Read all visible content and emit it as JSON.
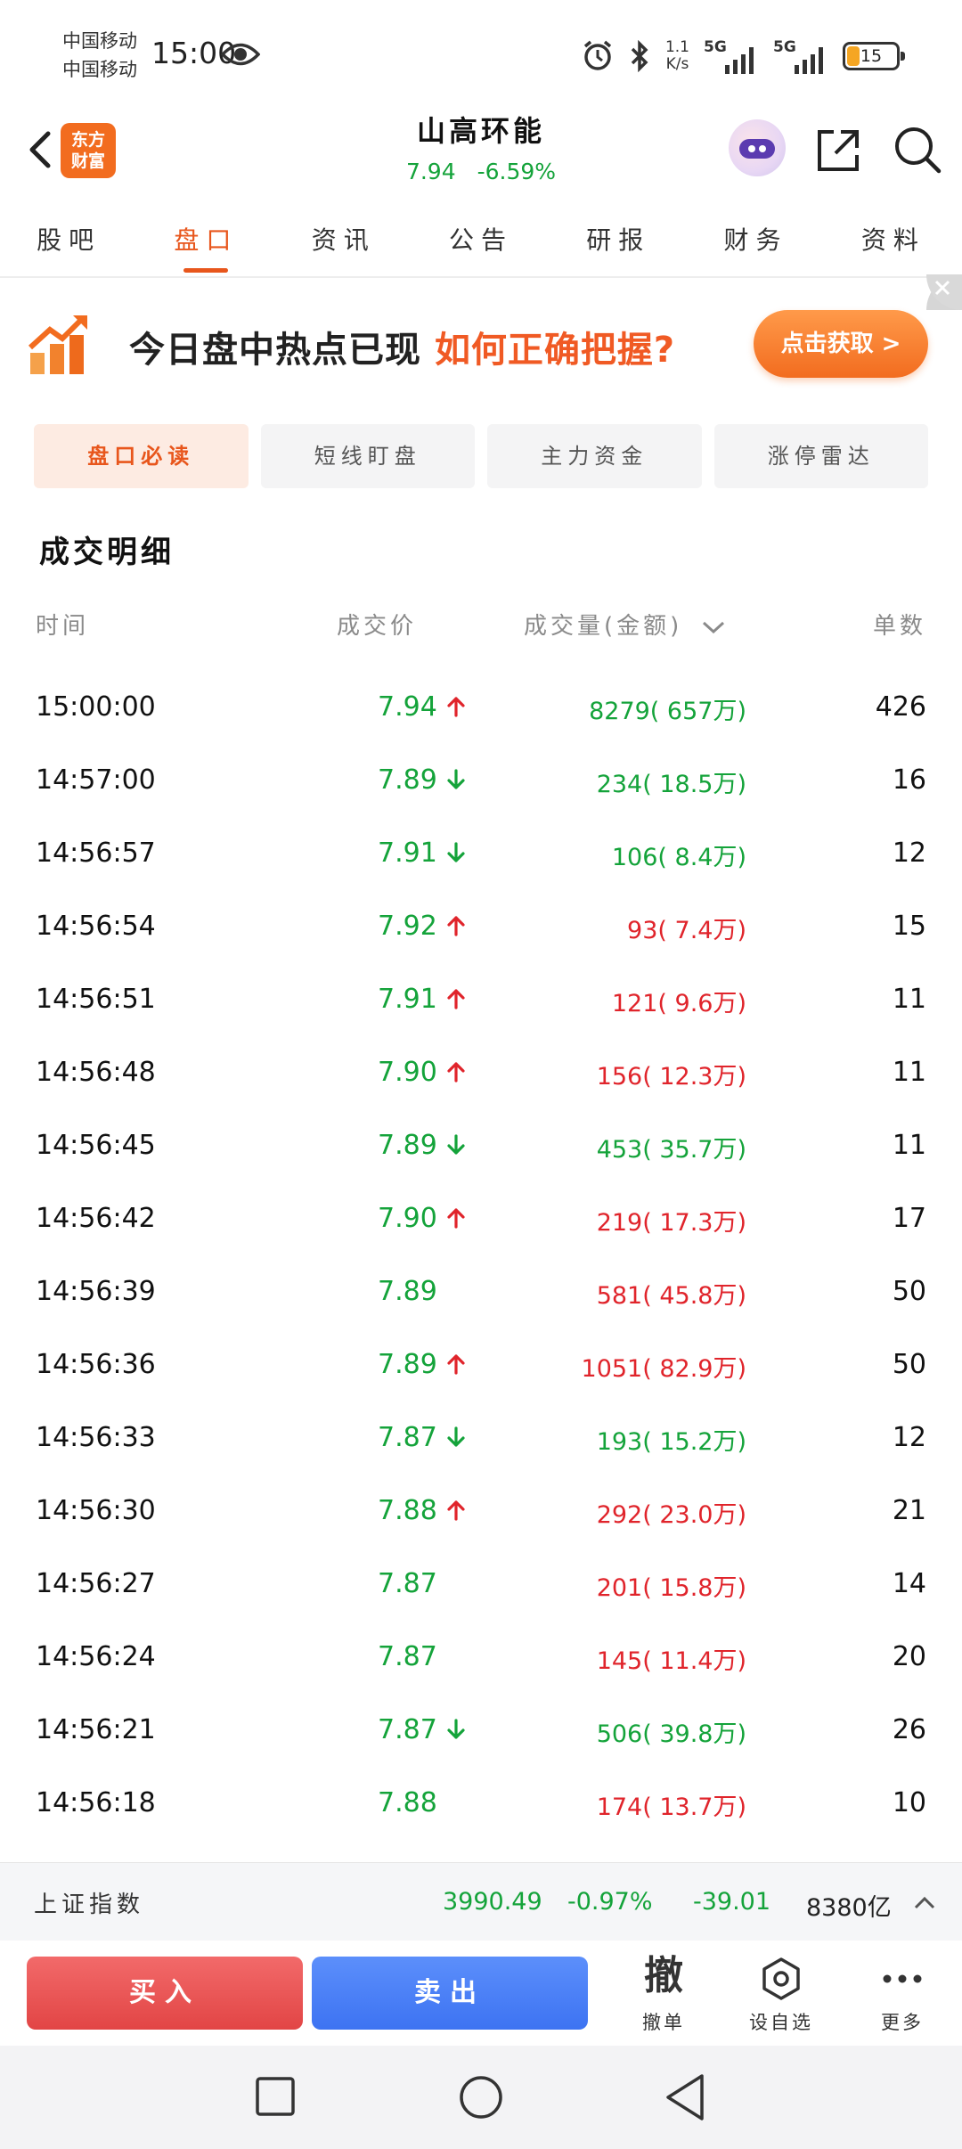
{
  "status_bar": {
    "carrier_line1": "中国移动",
    "carrier_line2": "中国移动",
    "time": "15:00",
    "net_speed_value": "1.1",
    "net_speed_unit": "K/s",
    "signal1_label": "5G",
    "signal2_label": "5G",
    "battery_level": "15"
  },
  "header": {
    "brand_line1": "东方",
    "brand_line2": "财富",
    "stock_name": "山高环能",
    "price": "7.94",
    "change_pct": "-6.59%"
  },
  "tabs": [
    {
      "label": "股吧",
      "active": false
    },
    {
      "label": "盘口",
      "active": true
    },
    {
      "label": "资讯",
      "active": false
    },
    {
      "label": "公告",
      "active": false
    },
    {
      "label": "研报",
      "active": false
    },
    {
      "label": "财务",
      "active": false
    },
    {
      "label": "资料",
      "active": false
    }
  ],
  "banner": {
    "text_main": "今日盘中热点已现",
    "text_highlight": "如何正确把握?",
    "button_label": "点击获取 >"
  },
  "subtabs": [
    {
      "label": "盘口必读",
      "active": true
    },
    {
      "label": "短线盯盘",
      "active": false
    },
    {
      "label": "主力资金",
      "active": false
    },
    {
      "label": "涨停雷达",
      "active": false
    }
  ],
  "section_title": "成交明细",
  "table": {
    "headers": {
      "time": "时间",
      "price": "成交价",
      "volume": "成交量(金额)",
      "count": "单数"
    },
    "rows": [
      {
        "time": "15:00:00",
        "price": "7.94",
        "arrow": "up",
        "volume": "8279( 657万)",
        "vol_color": "green",
        "count": "426"
      },
      {
        "time": "14:57:00",
        "price": "7.89",
        "arrow": "down",
        "volume": "234( 18.5万)",
        "vol_color": "green",
        "count": "16"
      },
      {
        "time": "14:56:57",
        "price": "7.91",
        "arrow": "down",
        "volume": "106( 8.4万)",
        "vol_color": "green",
        "count": "12"
      },
      {
        "time": "14:56:54",
        "price": "7.92",
        "arrow": "up",
        "volume": "93( 7.4万)",
        "vol_color": "red",
        "count": "15"
      },
      {
        "time": "14:56:51",
        "price": "7.91",
        "arrow": "up",
        "volume": "121( 9.6万)",
        "vol_color": "red",
        "count": "11"
      },
      {
        "time": "14:56:48",
        "price": "7.90",
        "arrow": "up",
        "volume": "156( 12.3万)",
        "vol_color": "red",
        "count": "11"
      },
      {
        "time": "14:56:45",
        "price": "7.89",
        "arrow": "down",
        "volume": "453( 35.7万)",
        "vol_color": "green",
        "count": "11"
      },
      {
        "time": "14:56:42",
        "price": "7.90",
        "arrow": "up",
        "volume": "219( 17.3万)",
        "vol_color": "red",
        "count": "17"
      },
      {
        "time": "14:56:39",
        "price": "7.89",
        "arrow": "none",
        "volume": "581( 45.8万)",
        "vol_color": "red",
        "count": "50"
      },
      {
        "time": "14:56:36",
        "price": "7.89",
        "arrow": "up",
        "volume": "1051( 82.9万)",
        "vol_color": "red",
        "count": "50"
      },
      {
        "time": "14:56:33",
        "price": "7.87",
        "arrow": "down",
        "volume": "193( 15.2万)",
        "vol_color": "green",
        "count": "12"
      },
      {
        "time": "14:56:30",
        "price": "7.88",
        "arrow": "up",
        "volume": "292( 23.0万)",
        "vol_color": "red",
        "count": "21"
      },
      {
        "time": "14:56:27",
        "price": "7.87",
        "arrow": "none",
        "volume": "201( 15.8万)",
        "vol_color": "red",
        "count": "14"
      },
      {
        "time": "14:56:24",
        "price": "7.87",
        "arrow": "none",
        "volume": "145( 11.4万)",
        "vol_color": "red",
        "count": "20"
      },
      {
        "time": "14:56:21",
        "price": "7.87",
        "arrow": "down",
        "volume": "506( 39.8万)",
        "vol_color": "green",
        "count": "26"
      },
      {
        "time": "14:56:18",
        "price": "7.88",
        "arrow": "none",
        "volume": "174( 13.7万)",
        "vol_color": "red",
        "count": "10"
      }
    ]
  },
  "index_bar": {
    "name": "上证指数",
    "value": "3990.49",
    "change_pct": "-0.97%",
    "change": "-39.01",
    "turnover": "8380亿"
  },
  "actions": {
    "buy_label": "买入",
    "sell_label": "卖出",
    "cancel_glyph": "撤",
    "cancel_label": "撤单",
    "watch_label": "设自选",
    "more_label": "更多"
  },
  "colors": {
    "accent": "#e8561c",
    "up_red": "#e0242b",
    "down_green": "#14a33a",
    "buy": "#e24545",
    "sell": "#3d73f2"
  }
}
